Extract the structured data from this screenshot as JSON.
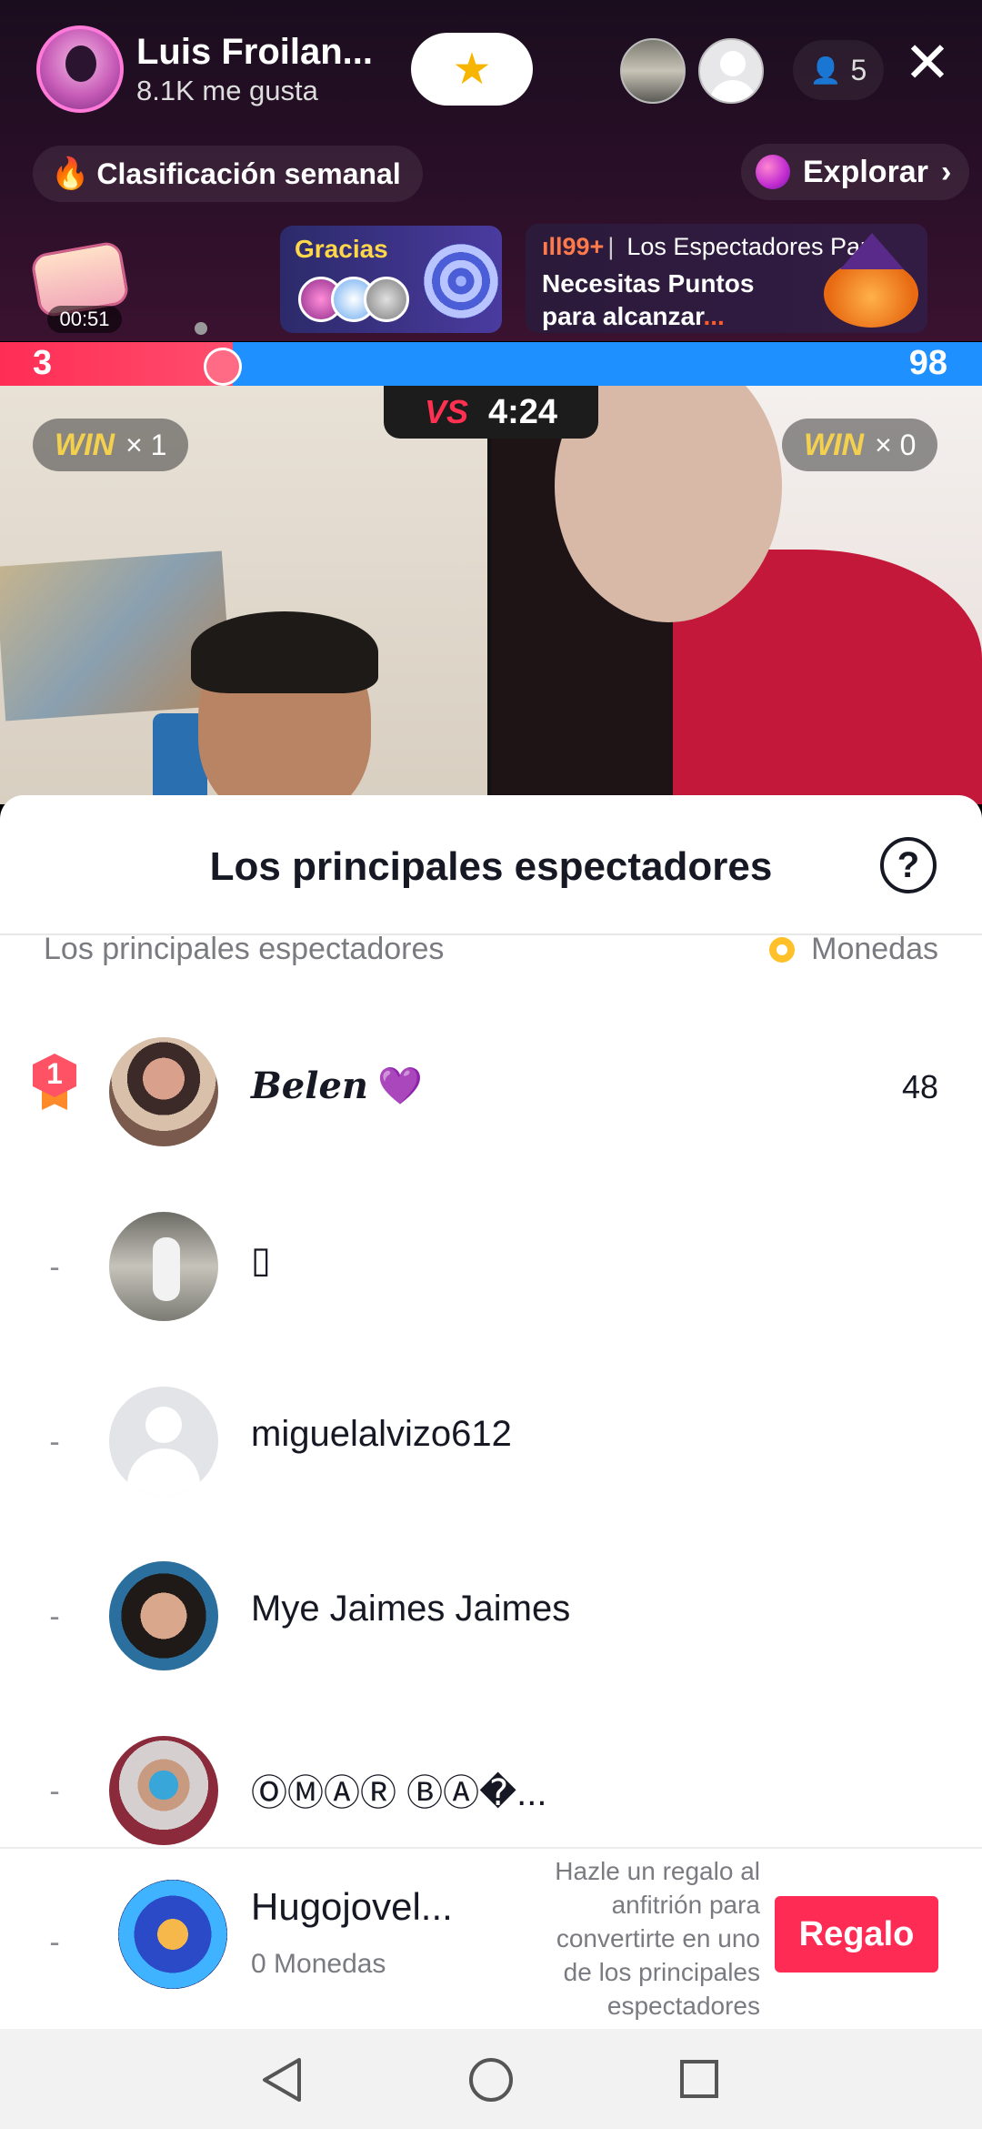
{
  "host": {
    "name": "Luis Froilan...",
    "likes": "8.1K me gusta",
    "follow_icon": "star-icon"
  },
  "viewers": {
    "count": "5"
  },
  "chips": {
    "ranking": "Clasificación semanal",
    "explore": "Explorar"
  },
  "chest": {
    "timer": "00:51"
  },
  "gracias_card": {
    "title": "Gracias"
  },
  "promo_card": {
    "count": "99+",
    "tag": "Los Espectadores Par",
    "line1": "Necesitas Puntos",
    "line2": "para alcanzar",
    "ellipsis": "..."
  },
  "battle": {
    "left_score": "3",
    "right_score": "98",
    "vs": "VS",
    "timer": "4:24",
    "left_win_label": "WIN",
    "left_win_count": "× 1",
    "right_win_label": "WIN",
    "right_win_count": "× 0"
  },
  "sheet": {
    "title": "Los principales espectadores",
    "col_left": "Los principales espectadores",
    "col_right": "Monedas"
  },
  "viewers_list": [
    {
      "rank": "1",
      "name": "Belen",
      "emoji": "💜",
      "coins": "48"
    },
    {
      "rank": "-",
      "name": "▯",
      "coins": ""
    },
    {
      "rank": "-",
      "name": "miguelalvizo612",
      "coins": ""
    },
    {
      "rank": "-",
      "name": "Mye Jaimes Jaimes",
      "coins": ""
    },
    {
      "rank": "-",
      "name": "ⓄⓂⒶⓇ ⒷⒶ�...",
      "coins": ""
    }
  ],
  "self": {
    "rank": "-",
    "name": "Hugojovel...",
    "coins": "0 Monedas",
    "note": "Hazle un regalo al anfitrión para convertirte en uno de los principales espectadores",
    "gift_label": "Regalo"
  },
  "colors": {
    "accent": "#fe2c55",
    "battle_red": "#ff2d55",
    "battle_blue": "#1e90ff"
  }
}
